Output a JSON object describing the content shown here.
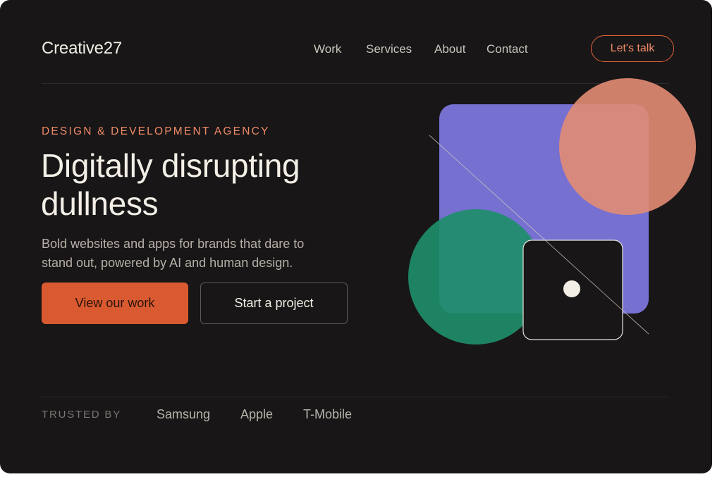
{
  "header": {
    "logo": "Creative27",
    "nav": [
      {
        "id": "work",
        "label": "Work"
      },
      {
        "id": "services",
        "label": "Services"
      },
      {
        "id": "about",
        "label": "About"
      },
      {
        "id": "contact",
        "label": "Contact"
      }
    ],
    "cta_label": "Let's talk"
  },
  "hero": {
    "eyebrow": "DESIGN & DEVELOPMENT AGENCY",
    "headline_line1": "Digitally disrupting",
    "headline_line2": "dullness",
    "subcopy": "Bold websites and apps for brands that dare to stand out, powered by AI and human design.",
    "primary_button": "View our work",
    "secondary_button": "Start a project"
  },
  "trusted": {
    "label": "TRUSTED BY",
    "brands": [
      "Samsung",
      "Apple",
      "T-Mobile"
    ]
  },
  "colors": {
    "background": "#181617",
    "accent": "#d95a30",
    "purple_square": "#7670d1",
    "peach_circle": "#e38c74",
    "green_circle": "#1e8d6a",
    "text_primary": "#f3eee6"
  }
}
